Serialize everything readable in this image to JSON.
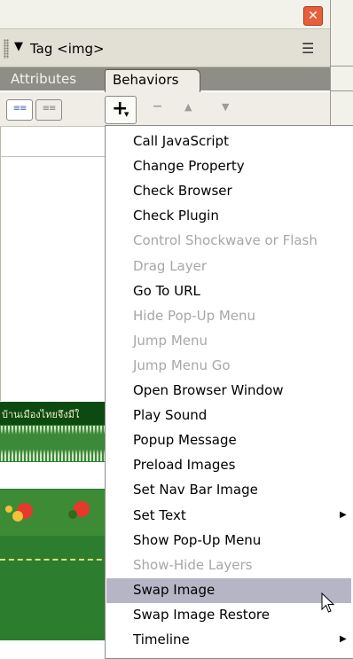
{
  "panel": {
    "title": "Tag <img>",
    "title_arrow": "▼",
    "options_icon": "☰",
    "close": "✕"
  },
  "tabs": {
    "attributes": "Attributes",
    "behaviors": "Behaviors"
  },
  "toolbar": {
    "add": "+",
    "add_dropdown": "▼",
    "remove": "–",
    "up": "▲",
    "down": "▼",
    "view1": "≡≡",
    "view2": "≡≡"
  },
  "design_view": {
    "thai_text": "บ้านเมืองไทยจึงมีใ"
  },
  "menu": {
    "items": [
      {
        "label": "Call JavaScript",
        "enabled": true
      },
      {
        "label": "Change Property",
        "enabled": true
      },
      {
        "label": "Check Browser",
        "enabled": true
      },
      {
        "label": "Check Plugin",
        "enabled": true
      },
      {
        "label": "Control Shockwave or Flash",
        "enabled": false
      },
      {
        "label": "Drag Layer",
        "enabled": false
      },
      {
        "label": "Go To URL",
        "enabled": true
      },
      {
        "label": "Hide Pop-Up Menu",
        "enabled": false
      },
      {
        "label": "Jump Menu",
        "enabled": false
      },
      {
        "label": "Jump Menu Go",
        "enabled": false
      },
      {
        "label": "Open Browser Window",
        "enabled": true
      },
      {
        "label": "Play Sound",
        "enabled": true
      },
      {
        "label": "Popup Message",
        "enabled": true
      },
      {
        "label": "Preload Images",
        "enabled": true
      },
      {
        "label": "Set Nav Bar Image",
        "enabled": true
      },
      {
        "label": "Set Text",
        "enabled": true,
        "submenu": true
      },
      {
        "label": "Show Pop-Up Menu",
        "enabled": true
      },
      {
        "label": "Show-Hide Layers",
        "enabled": false
      },
      {
        "label": "Swap Image",
        "enabled": true,
        "selected": true
      },
      {
        "label": "Swap Image Restore",
        "enabled": true
      },
      {
        "label": "Timeline",
        "enabled": true,
        "submenu": true
      }
    ],
    "submenu_arrow": "▶"
  }
}
